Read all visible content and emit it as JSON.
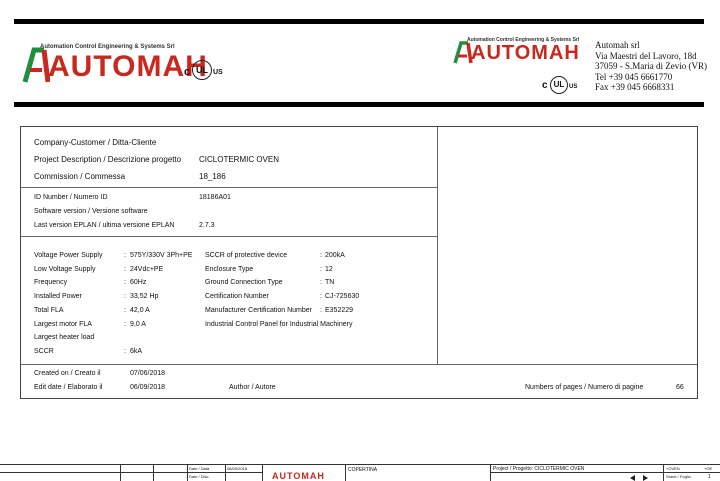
{
  "logo_left": {
    "tagline": "Automation Control Engineering & Systems Srl",
    "word": "AUTOMAH",
    "cert_c": "c",
    "cert_ul": "UL",
    "cert_us": "US"
  },
  "logo_right": {
    "tagline": "Automation Control Engineering & Systems Srl",
    "word": "AUTOMAH",
    "cert_c": "c",
    "cert_ul": "UL",
    "cert_us": "US"
  },
  "company": {
    "name": "Automah srl",
    "address1": "Via Maestri del Lavoro, 18d",
    "address2": "37059 - S.Maria di Zevio (VR)",
    "tel": "Tel +39 045 6661770",
    "fax": "Fax +39 045 6668331"
  },
  "project": {
    "customer_label": "Company-Customer / Ditta-Cliente",
    "customer_value": "",
    "description_label": "Project Description / Descrizione progetto",
    "description_value": "CICLOTERMIC OVEN",
    "commission_label": "Commission / Commessa",
    "commission_value": "18_186",
    "id_label": "ID Number / Numero ID",
    "id_value": "18186A01",
    "sw_label": "Software version / Versione software",
    "sw_value": "",
    "eplan_label": "Last version EPLAN / ultima versione EPLAN",
    "eplan_value": "2.7.3"
  },
  "specs_left": [
    {
      "label": "Voltage Power Supply",
      "value": "575Y/330V 3Ph+PE"
    },
    {
      "label": "Low Voltage Supply",
      "value": "24Vdc+PE"
    },
    {
      "label": "Frequency",
      "value": "60Hz"
    },
    {
      "label": "Installed Power",
      "value": "33,52 Hp"
    },
    {
      "label": "Total FLA",
      "value": "42,0 A"
    },
    {
      "label": "Largest motor FLA",
      "value": "9,0 A"
    },
    {
      "label": "Largest heater load",
      "value": ""
    },
    {
      "label": "SCCR",
      "value": "6kA"
    }
  ],
  "specs_right": [
    {
      "label": "SCCR of protective device",
      "value": "200kA"
    },
    {
      "label": "Enclosure Type",
      "value": "12"
    },
    {
      "label": "Ground Connection Type",
      "value": "TN"
    },
    {
      "label": "Certification Number",
      "value": "CJ-725630"
    },
    {
      "label": "Manufacturer Certification Number",
      "value": "E352229"
    }
  ],
  "panel_note": "Industrial Control Panel for Industrial Machinery",
  "footer": {
    "created_label": "Created on / Creato il",
    "created_value": "07/06/2018",
    "edited_label": "Edit date / Elaborato il",
    "edited_value": "06/09/2018",
    "author_label": "Author / Autore",
    "pages_label": "Numbers of pages / Numero di pagine",
    "pages_value": "66"
  },
  "titleblock": {
    "date_label": "Date / Data",
    "date_value": "06/09/2018",
    "disc_label": "Date / Disc.",
    "sheet_title": "COPERTINA",
    "project_label": "Project / Progetto: CICLOTERMIC OVEN",
    "plus": "+OVEN",
    "eq": "+OE",
    "sheet_label": "Sheet / Foglio",
    "sheet_value": "1"
  }
}
